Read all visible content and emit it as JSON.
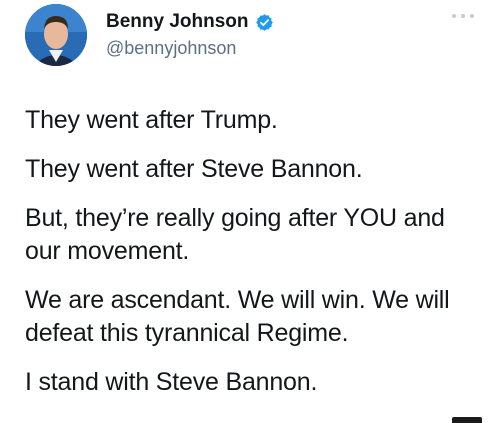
{
  "author": {
    "display_name": "Benny Johnson",
    "handle": "@bennyjohnson",
    "verified": true
  },
  "tweet": {
    "paragraphs": [
      "They went after Trump.",
      "They went after Steve Bannon.",
      "But, they’re really going after YOU and our movement.",
      "We are ascendant. We will win. We will defeat this tyrannical Regime.",
      "I stand with Steve Bannon."
    ]
  },
  "icons": {
    "avatar": "profile-photo",
    "verified": "verified-badge-icon",
    "more": "more-options-icon"
  },
  "colors": {
    "verified_blue": "#1d9bf0",
    "handle_gray": "#5b7083",
    "text": "#14171a"
  }
}
